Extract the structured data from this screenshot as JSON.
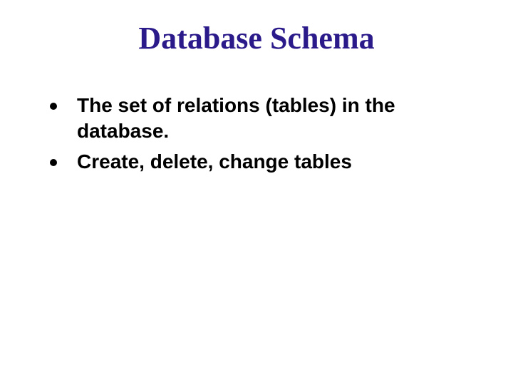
{
  "title": "Database Schema",
  "bullets": [
    "The set of relations (tables) in the database.",
    "Create, delete, change tables"
  ]
}
